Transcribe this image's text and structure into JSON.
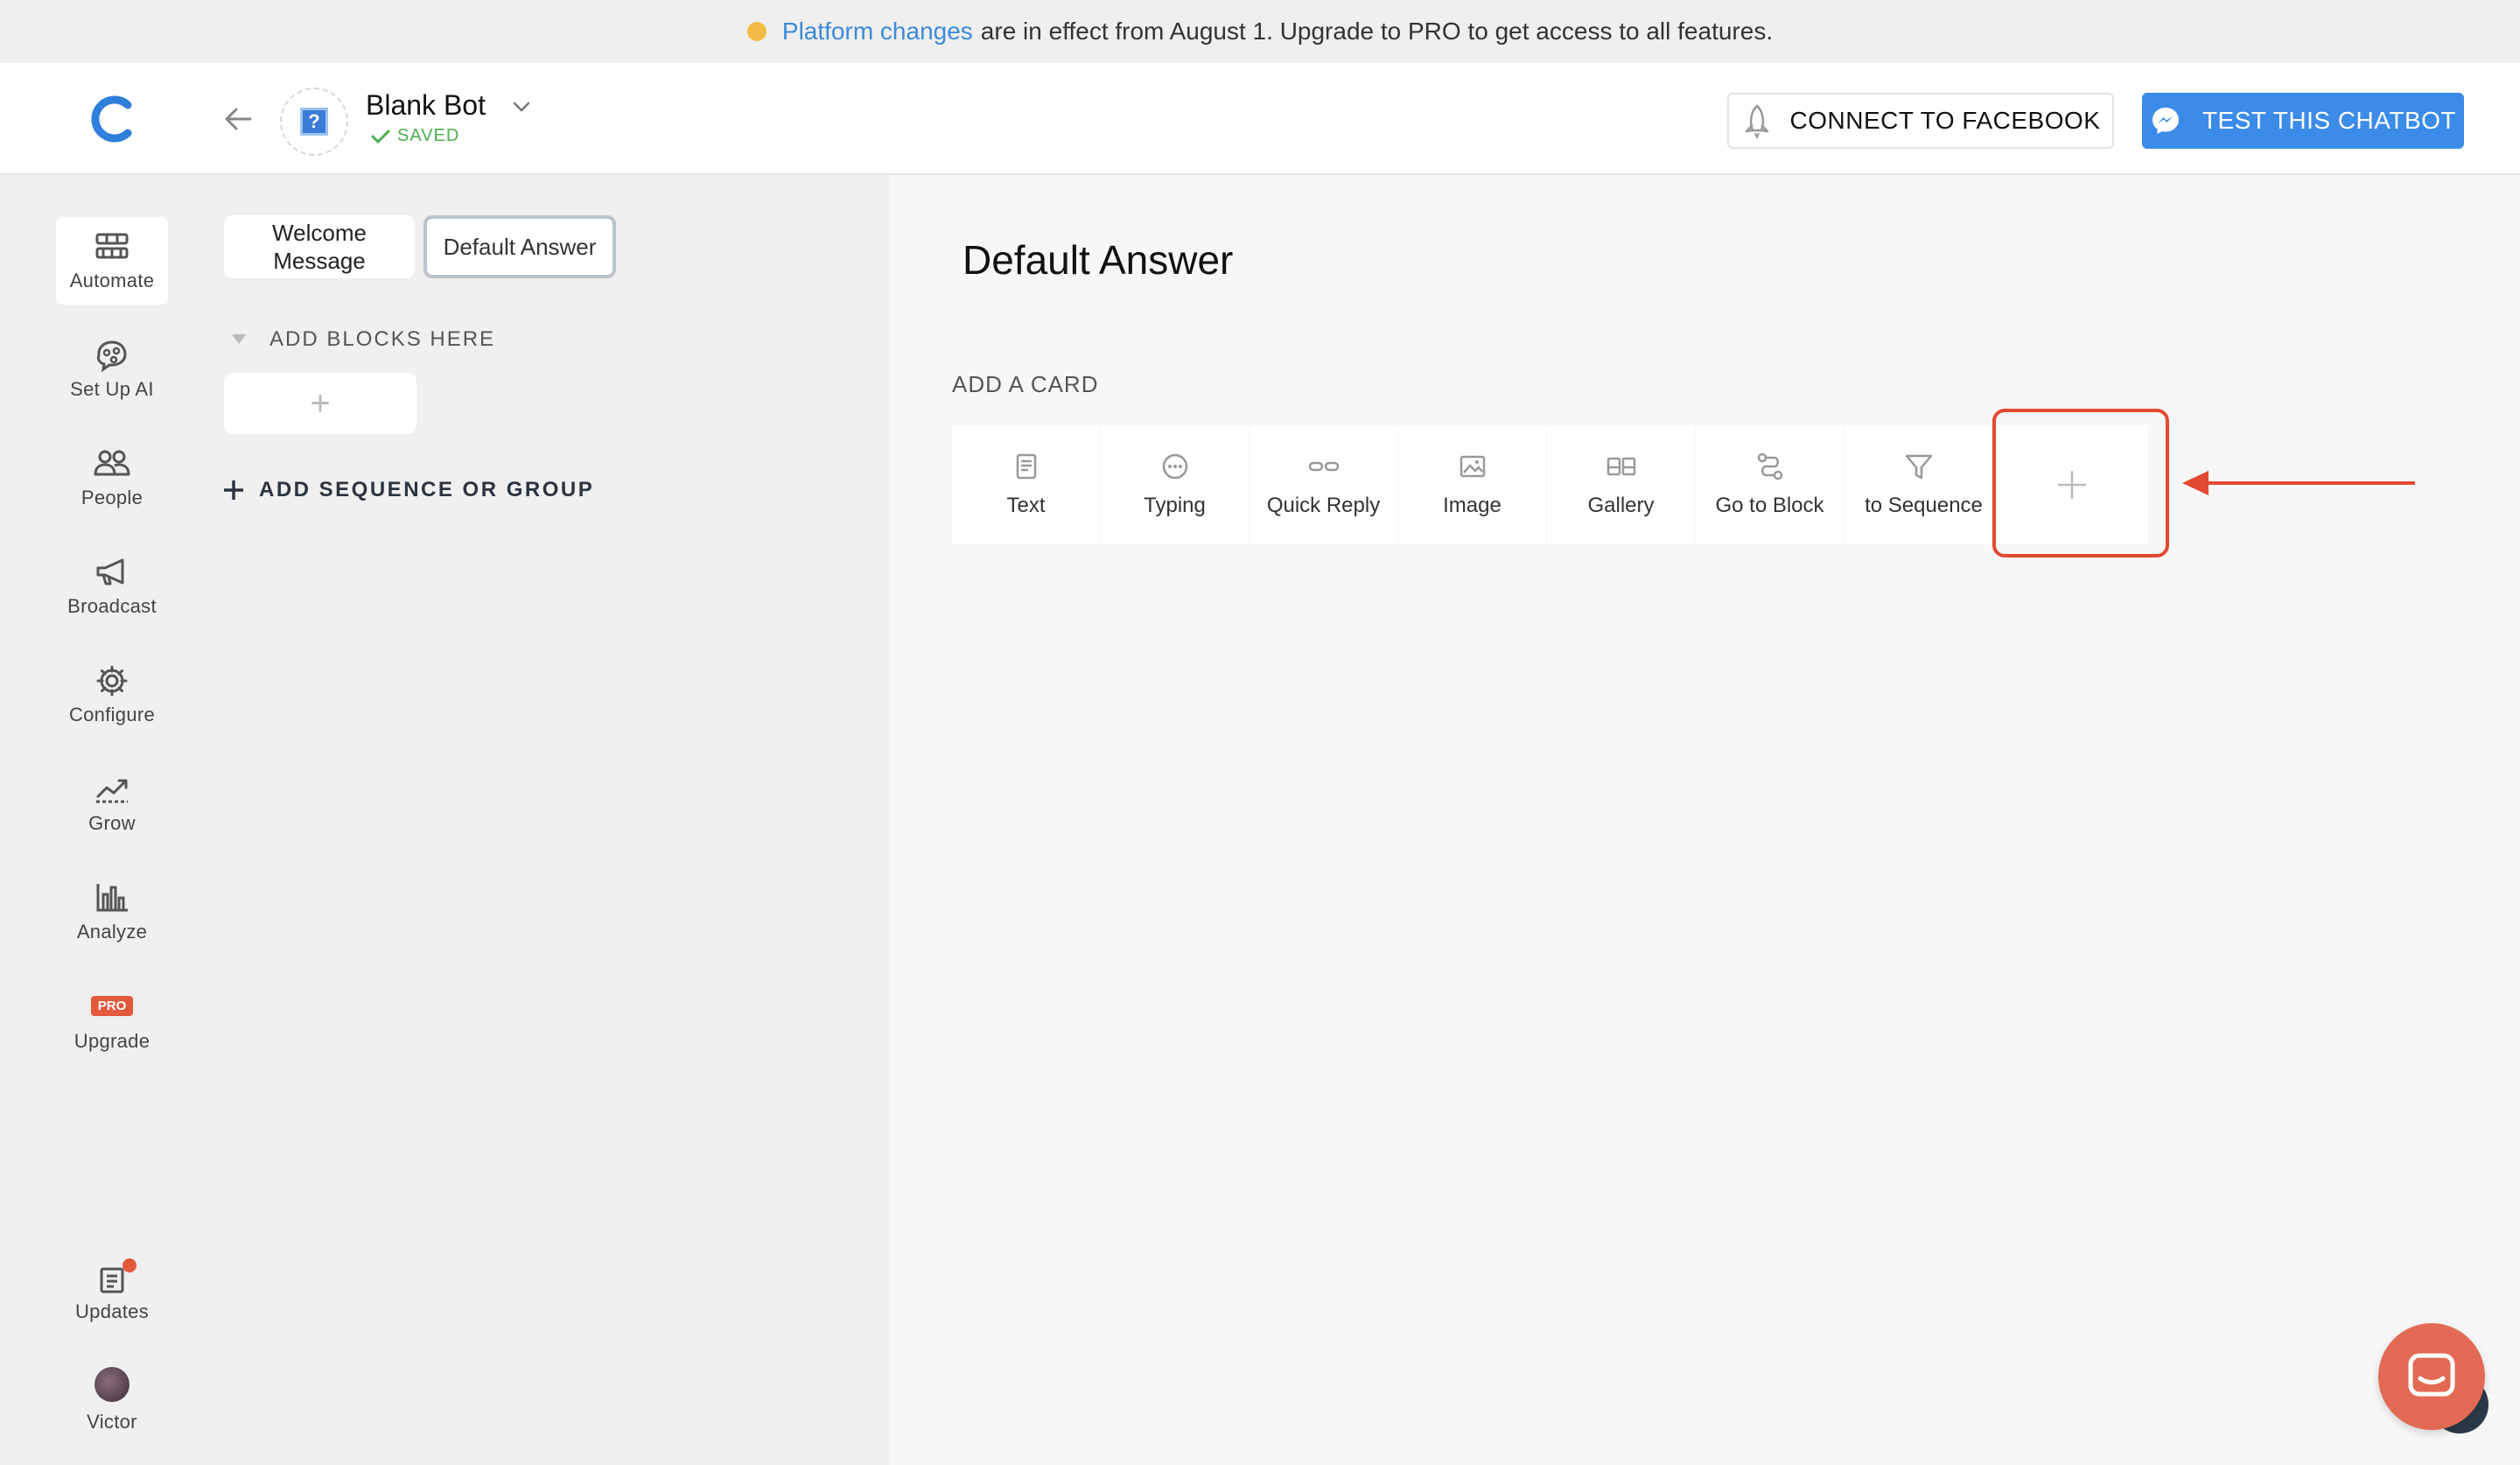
{
  "banner": {
    "link_text": "Platform changes",
    "text": "are in effect from August 1. Upgrade to PRO to get access to all features."
  },
  "header": {
    "bot_name": "Blank Bot",
    "status": "SAVED",
    "avatar_glyph": "?",
    "connect_label": "CONNECT TO FACEBOOK",
    "test_label": "TEST THIS CHATBOT"
  },
  "nav": {
    "automate": "Automate",
    "setup_ai": "Set Up AI",
    "people": "People",
    "broadcast": "Broadcast",
    "configure": "Configure",
    "grow": "Grow",
    "analyze": "Analyze",
    "pro_badge": "PRO",
    "upgrade": "Upgrade",
    "updates": "Updates",
    "user": "Victor"
  },
  "blocks": {
    "welcome": "Welcome Message",
    "default": "Default Answer",
    "add_blocks": "ADD BLOCKS HERE",
    "add_block_plus": "+",
    "add_sequence": "ADD SEQUENCE OR GROUP"
  },
  "main": {
    "title": "Default Answer",
    "add_card": "ADD A CARD",
    "cards": [
      "Text",
      "Typing",
      "Quick Reply",
      "Image",
      "Gallery",
      "Go to Block",
      "to Sequence"
    ],
    "plus": "+"
  },
  "colors": {
    "accent": "#3b8be8",
    "highlight": "#e24a31",
    "pro": "#e2593b",
    "banner_dot": "#f3bb45"
  }
}
